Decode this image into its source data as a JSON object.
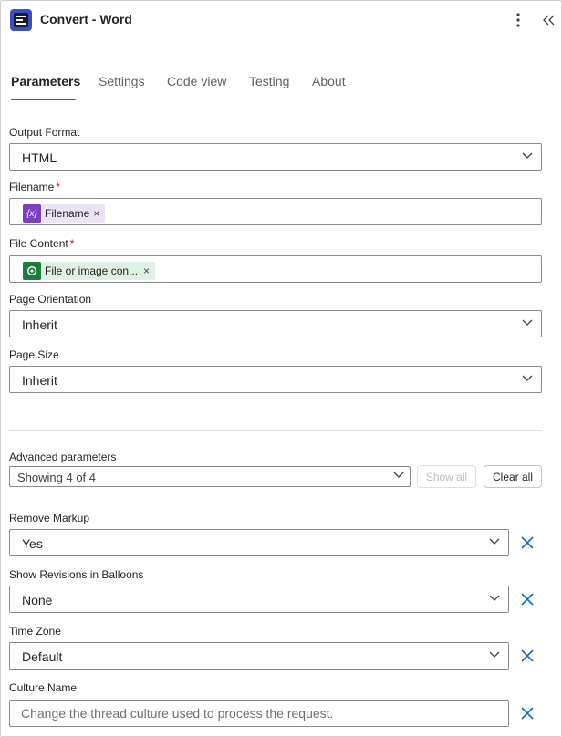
{
  "header": {
    "title": "Convert - Word",
    "app_icon": "document-logo-icon",
    "more_icon": "more-vertical-icon",
    "collapse_icon": "double-chevron-left-icon"
  },
  "tabs": [
    {
      "label": "Parameters",
      "active": true
    },
    {
      "label": "Settings",
      "active": false
    },
    {
      "label": "Code view",
      "active": false
    },
    {
      "label": "Testing",
      "active": false
    },
    {
      "label": "About",
      "active": false
    }
  ],
  "fields": {
    "output_format": {
      "label": "Output Format",
      "value": "HTML"
    },
    "filename": {
      "label": "Filename",
      "required": "*",
      "token_label": "Filename",
      "token_icon_text": "{x}",
      "token_remove": "×"
    },
    "file_content": {
      "label": "File Content",
      "required": "*",
      "token_label": "File or image con...",
      "token_remove": "×"
    },
    "page_orientation": {
      "label": "Page Orientation",
      "value": "Inherit"
    },
    "page_size": {
      "label": "Page Size",
      "value": "Inherit"
    }
  },
  "advanced": {
    "label": "Advanced parameters",
    "selected": "Showing 4 of 4",
    "show_all": "Show all",
    "clear_all": "Clear all"
  },
  "advanced_fields": {
    "remove_markup": {
      "label": "Remove Markup",
      "value": "Yes"
    },
    "show_revisions": {
      "label": "Show Revisions in Balloons",
      "value": "None"
    },
    "time_zone": {
      "label": "Time Zone",
      "value": "Default"
    },
    "culture_name": {
      "label": "Culture Name",
      "placeholder": "Change the thread culture used to process the request."
    }
  },
  "colors": {
    "accent": "#0f6cbd",
    "variable_token_bg": "#ece4f6",
    "variable_token_icon": "#7b3fc4",
    "content_token_bg": "#dff0e4",
    "content_token_icon": "#1f7a3d",
    "required": "#c50f1f"
  }
}
